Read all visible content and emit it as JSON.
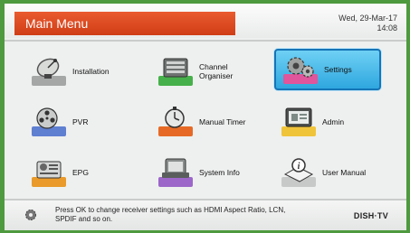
{
  "header": {
    "title": "Main Menu",
    "date": "Wed, 29-Mar-17",
    "time": "14:08"
  },
  "menu": {
    "selected": "Settings",
    "items": [
      {
        "label_lines": [
          "Installation"
        ],
        "icon": "satellite-dish-icon",
        "pad_color": "#a4a7a6"
      },
      {
        "label_lines": [
          "Channel",
          "Organiser"
        ],
        "icon": "channel-list-icon",
        "pad_color": "#46b04a"
      },
      {
        "label_lines": [
          "Settings"
        ],
        "icon": "gears-icon",
        "pad_color": "#e0559b"
      },
      {
        "label_lines": [
          "PVR"
        ],
        "icon": "film-reel-icon",
        "pad_color": "#5f7fd1"
      },
      {
        "label_lines": [
          "Manual Timer"
        ],
        "icon": "stopwatch-icon",
        "pad_color": "#e66a26"
      },
      {
        "label_lines": [
          "Admin"
        ],
        "icon": "monitor-icon",
        "pad_color": "#f0c43a"
      },
      {
        "label_lines": [
          "EPG"
        ],
        "icon": "guide-icon",
        "pad_color": "#e99a2a"
      },
      {
        "label_lines": [
          "System Info"
        ],
        "icon": "stb-info-icon",
        "pad_color": "#9c67c9"
      },
      {
        "label_lines": [
          "User Manual"
        ],
        "icon": "info-book-icon",
        "pad_color": "#c7c9c8"
      }
    ]
  },
  "footer": {
    "hint": "Press OK to change receiver settings such as HDMI Aspect Ratio, LCN, SPDIF and so on.",
    "brand": "DISH·TV",
    "hint_icon": "gear-icon"
  }
}
